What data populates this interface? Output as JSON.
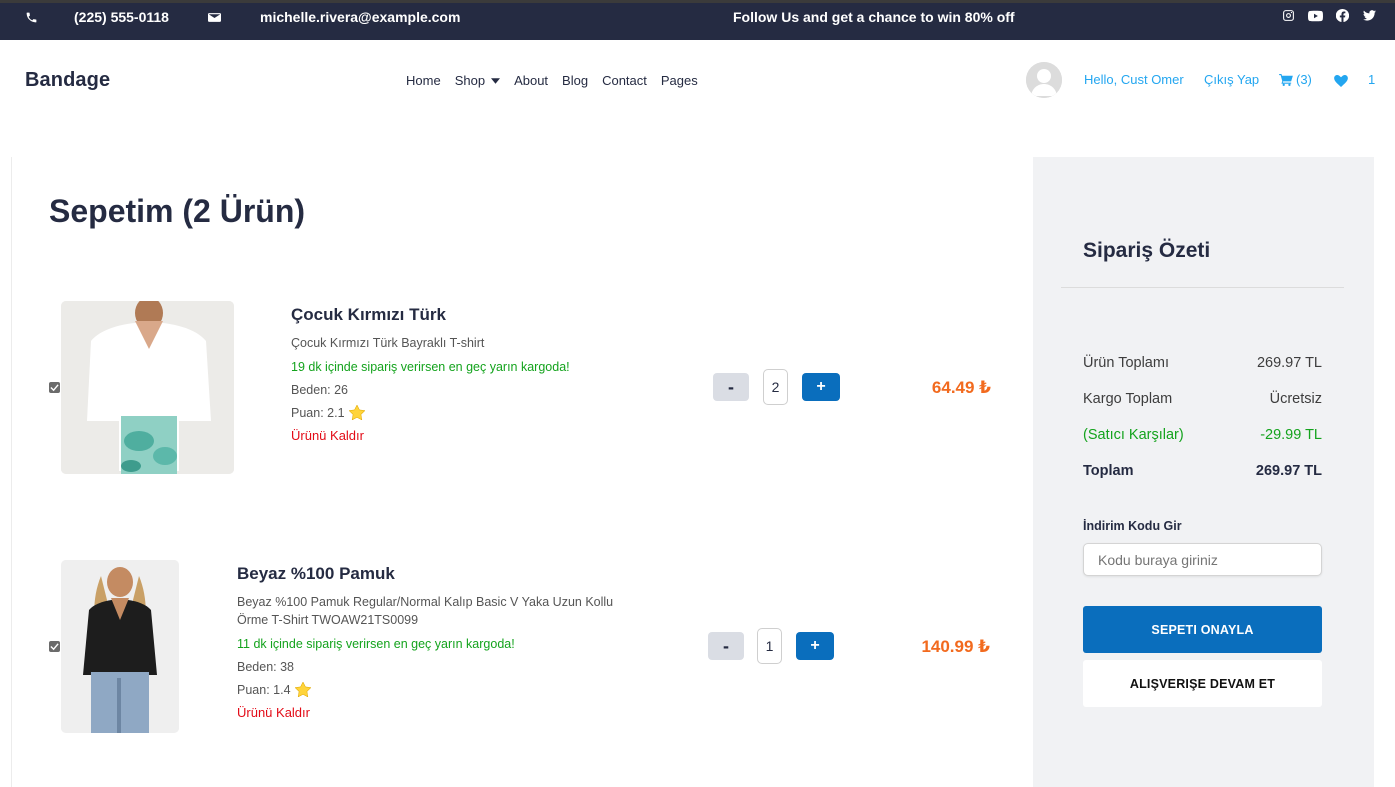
{
  "topbar": {
    "phone": "(225) 555-0118",
    "email": "michelle.rivera@example.com",
    "promo": "Follow Us and get a chance to win 80% off",
    "social_icons": [
      "instagram-icon",
      "youtube-icon",
      "facebook-icon",
      "twitter-icon"
    ]
  },
  "header": {
    "brand": "Bandage",
    "nav": [
      "Home",
      "Shop",
      "About",
      "Blog",
      "Contact",
      "Pages"
    ],
    "greeting": "Hello, Cust Omer",
    "logout": "Çıkış Yap",
    "cart_count": "(3)",
    "favorites_count": "1"
  },
  "cart": {
    "title": "Sepetim (2 Ürün)",
    "items": [
      {
        "checked": true,
        "name": "Çocuk Kırmızı Türk",
        "description": "Çocuk Kırmızı Türk Bayraklı T-shirt",
        "shipping": "19 dk içinde sipariş verirsen en geç yarın kargoda!",
        "size": "Beden: 26",
        "rating": "Puan: 2.1",
        "remove": "Ürünü Kaldır",
        "minus": "-",
        "quantity": "2",
        "plus": "+",
        "price": "64.49 ₺"
      },
      {
        "checked": true,
        "name": "Beyaz %100 Pamuk",
        "description": "Beyaz %100 Pamuk Regular/Normal Kalıp Basic V Yaka Uzun Kollu Örme T-Shirt TWOAW21TS0099",
        "shipping": "11 dk içinde sipariş verirsen en geç yarın kargoda!",
        "size": "Beden: 38",
        "rating": "Puan: 1.4",
        "remove": "Ürünü Kaldır",
        "minus": "-",
        "quantity": "1",
        "plus": "+",
        "price": "140.99 ₺"
      }
    ]
  },
  "summary": {
    "title": "Sipariş Özeti",
    "rows": [
      {
        "label": "Ürün Toplamı",
        "value": "269.97 TL"
      },
      {
        "label": "Kargo Toplam",
        "value": "Ücretsiz"
      },
      {
        "label": "(Satıcı Karşılar)",
        "value": "-29.99 TL"
      },
      {
        "label": "Toplam",
        "value": "269.97 TL"
      }
    ],
    "discount_label": "İndirim Kodu Gir",
    "discount_placeholder": "Kodu buraya giriniz",
    "confirm_button": "SEPETI ONAYLA",
    "continue_button": "ALIŞVERIŞE DEVAM ET"
  },
  "colors": {
    "topbar_bg": "#252b42",
    "accent_blue": "#23a6f0",
    "button_blue": "#0a6ebd",
    "price_orange": "#f26a1e",
    "success_green": "#14a31d",
    "danger_red": "#e30b17"
  }
}
